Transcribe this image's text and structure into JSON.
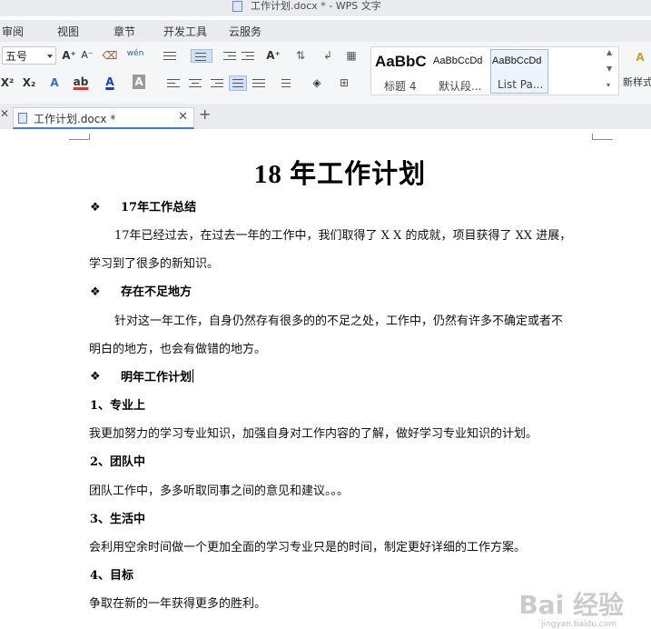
{
  "window": {
    "title": "工作计划.docx * - WPS 文字"
  },
  "menu": [
    "审阅",
    "视图",
    "章节",
    "开发工具",
    "云服务"
  ],
  "ribbon": {
    "font_size": "五号",
    "grow_font": "A⁺",
    "shrink_font": "A⁻",
    "phonetic": "wén",
    "superscript": "X²",
    "subscript": "X₂",
    "text_effect": "A",
    "highlight": "ab",
    "font_color": "A",
    "char_shading": "A",
    "highlight_color": "#e0322c",
    "font_color_value": "#1a3dc9",
    "styles": [
      {
        "sample": "AaBbC",
        "name": "标题 4"
      },
      {
        "sample": "AaBbCcDd",
        "name": "默认段..."
      },
      {
        "sample": "AaBbCcDd",
        "name": "List Pa..."
      }
    ],
    "new_style": "新样式"
  },
  "tabs": {
    "active": "工作计划.docx *"
  },
  "document": {
    "title": "18 年工作计划",
    "sections": [
      {
        "heading": "17年工作总结"
      },
      {
        "heading": "存在不足地方"
      },
      {
        "heading": "明年工作计划"
      }
    ],
    "summary_line1": "17年已经过去，在过去一年的工作中，我们取得了 X X 的成就，项目获得了 XX 进展，",
    "summary_line2": "学习到了很多的新知识。",
    "shortfall_line1": "针对这一年工作，自身仍然存有很多的的不足之处，工作中，仍然有许多不确定或者不",
    "shortfall_line2": "明白的地方，也会有做错的地方。",
    "items": [
      {
        "head": "1、专业上",
        "text": "我更加努力的学习专业知识，加强自身对工作内容的了解，做好学习专业知识的计划。"
      },
      {
        "head": "2、团队中",
        "text": "团队工作中，多多听取同事之间的意见和建议。。。"
      },
      {
        "head": "3、生活中",
        "text": "会利用空余时间做一个更加全面的学习专业只是的时间，制定更好详细的工作方案。"
      },
      {
        "head": "4、目标",
        "text": "争取在新的一年获得更多的胜利。"
      }
    ],
    "bullet_glyph": "❖"
  },
  "watermark": {
    "text": "Bai 经验",
    "url": "jingyan.baidu.com"
  }
}
